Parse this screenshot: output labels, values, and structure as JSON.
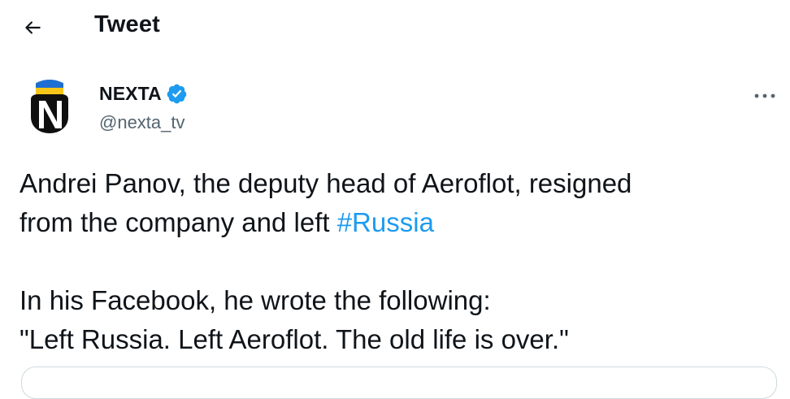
{
  "header": {
    "title": "Tweet",
    "back_icon": "arrow-left-icon"
  },
  "author": {
    "name": "NEXTA",
    "handle": "@nexta_tv",
    "verified_icon": "verified-badge-icon",
    "verified_color": "#1d9bf0"
  },
  "tweet": {
    "line1": "Andrei Panov, the deputy head of Aeroflot, resigned",
    "line2_prefix": "from the company and left ",
    "hashtag": "#Russia",
    "line3": "In his Facebook, he wrote the following:",
    "line4": "\"Left Russia. Left Aeroflot. The old life is over.\""
  },
  "more_icon": "more-horizontal-icon",
  "colors": {
    "text": "#0f1419",
    "secondary_text": "#536471",
    "link": "#1d9bf0",
    "border": "#cfd9de"
  }
}
